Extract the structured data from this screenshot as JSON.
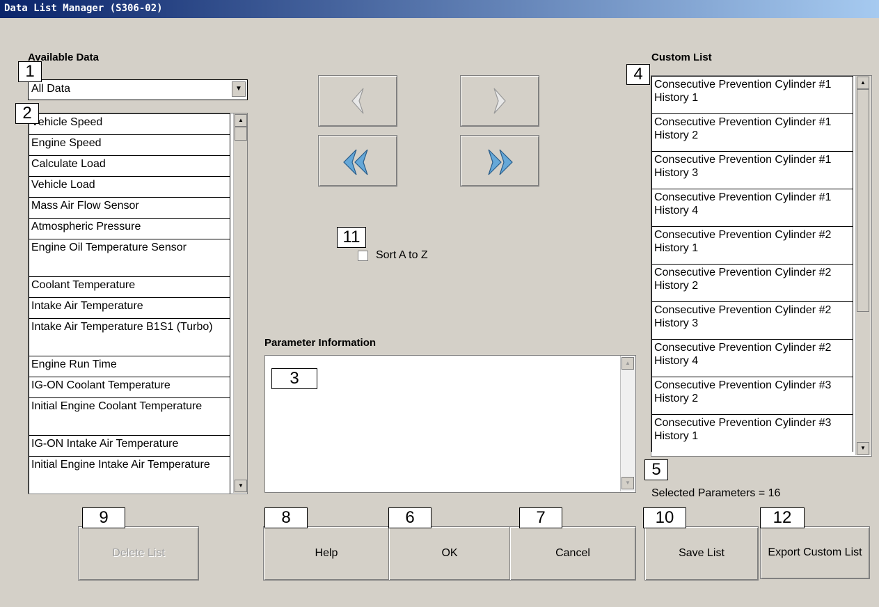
{
  "window": {
    "title": "Data List Manager (S306-02)"
  },
  "badges": {
    "b1": "1",
    "b2": "2",
    "b3": "3",
    "b4": "4",
    "b5": "5",
    "b6": "6",
    "b7": "7",
    "b8": "8",
    "b9": "9",
    "b10": "10",
    "b11": "11",
    "b12": "12"
  },
  "available": {
    "label": "Available Data",
    "filter_value": "All Data",
    "items": [
      "Vehicle Speed",
      "Engine Speed",
      "Calculate Load",
      "Vehicle Load",
      "Mass Air Flow Sensor",
      "Atmospheric Pressure",
      "Engine Oil Temperature Sensor",
      "Coolant Temperature",
      "Intake Air Temperature",
      "Intake Air Temperature B1S1 (Turbo)",
      "Engine Run Time",
      "IG-ON Coolant Temperature",
      "Initial Engine Coolant Temperature",
      "IG-ON Intake Air Temperature",
      "Initial Engine Intake Air Temperature"
    ]
  },
  "custom": {
    "label": "Custom List",
    "items": [
      "Consecutive Prevention Cylinder #1 History 1",
      "Consecutive Prevention Cylinder #1 History 2",
      "Consecutive Prevention Cylinder #1 History 3",
      "Consecutive Prevention Cylinder #1 History 4",
      "Consecutive Prevention Cylinder #2 History 1",
      "Consecutive Prevention Cylinder #2 History 2",
      "Consecutive Prevention Cylinder #2 History 3",
      "Consecutive Prevention Cylinder #2 History 4",
      "Consecutive Prevention Cylinder #3 History 2",
      "Consecutive Prevention Cylinder #3 History 1"
    ],
    "selected_text": "Selected Parameters = 16"
  },
  "sort": {
    "label": "Sort A to Z",
    "checked": false
  },
  "param_info": {
    "label": "Parameter Information",
    "text": ""
  },
  "buttons": {
    "delete": "Delete List",
    "help": "Help",
    "ok": "OK",
    "cancel": "Cancel",
    "save": "Save List",
    "export": "Export Custom List"
  },
  "icons": {
    "move_left": "arrow-left-icon",
    "move_right": "arrow-right-icon",
    "move_all_left": "double-arrow-left-icon",
    "move_all_right": "double-arrow-right-icon"
  },
  "colors": {
    "titlebar_start": "#0a246a",
    "titlebar_end": "#a6caf0",
    "window_bg": "#d4d0c8"
  }
}
